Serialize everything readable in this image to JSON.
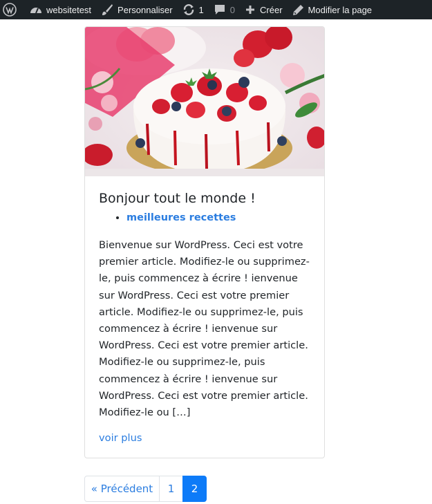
{
  "adminbar": {
    "site_name": "websitetest",
    "customize": "Personnaliser",
    "updates_count": "1",
    "comments_count": "0",
    "new_label": "Créer",
    "edit_page": "Modifier la page",
    "icons": [
      "wordpress-icon",
      "dashboard-icon",
      "brush-icon",
      "updates-icon",
      "comment-icon",
      "plus-icon",
      "pencil-icon"
    ]
  },
  "post": {
    "title": "Bonjour tout le monde !",
    "category": "meilleures recettes",
    "excerpt": "Bienvenue sur WordPress. Ceci est votre premier article. Modifiez-le ou supprimez-le, puis commencez à écrire ! ienvenue sur WordPress. Ceci est votre premier article. Modifiez-le ou supprimez-le, puis commencez à écrire ! ienvenue sur WordPress. Ceci est votre premier article. Modifiez-le ou supprimez-le, puis commencez à écrire ! ienvenue sur WordPress. Ceci est votre premier article. Modifiez-le ou […]",
    "read_more": "voir plus",
    "image": "pavlova cake with strawberries"
  },
  "pagination": {
    "prev": "« Précédent",
    "pages": [
      "1",
      "2"
    ],
    "current": "2"
  },
  "colors": {
    "adminbar_bg": "#1d2327",
    "link": "#2b7de0",
    "active_page": "#0d7bf8"
  }
}
